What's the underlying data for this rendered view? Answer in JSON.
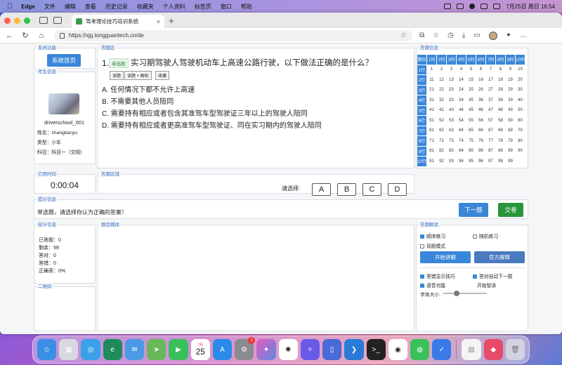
{
  "menubar": {
    "app": "Edge",
    "items": [
      "文件",
      "编辑",
      "查看",
      "历史记录",
      "收藏夹",
      "个人资料",
      "标签页",
      "窗口",
      "帮助"
    ],
    "datetime": "7月25日 周日 16:54"
  },
  "browser": {
    "tab_title": "驾考理论技巧培训系统",
    "url": "https://xjg.tongguantech.cn/de"
  },
  "system": {
    "title": "系统功能",
    "home_button": "系统首页"
  },
  "student": {
    "title": "考生信息",
    "username": "driverschool_001",
    "name_label": "姓名：",
    "name": "zhangtianyu",
    "type_label": "类型：",
    "type": "小车",
    "subject_label": "科目：",
    "subject": "科目一（交规）"
  },
  "question": {
    "area_title": "答题区",
    "number": "1.",
    "tag": "单选题",
    "text": "实习期驾驶人驾驶机动车上高速公路行驶，以下做法正确的是什么？",
    "buttons": [
      "读题",
      "读题 + 解析",
      "收藏"
    ],
    "options": [
      "A. 任何情况下都不允许上高速",
      "B. 不需要其他人员陪同",
      "C. 需要持有相应或者包含其准驾车型驾驶证三年以上的驾驶人陪同",
      "D. 需要持有相应或者更高准驾车型驾驶证、同在实习期内的驾驶人陪同"
    ]
  },
  "answer_info": {
    "title": "答题信息",
    "col_headers": [
      "题目",
      "1列",
      "2列",
      "3列",
      "4列",
      "5列",
      "6列",
      "7列",
      "8列",
      "9列",
      "10列"
    ],
    "row_headers": [
      "1行",
      "2行",
      "3行",
      "4行",
      "5行",
      "6行",
      "7行",
      "8行",
      "9行",
      "10行"
    ],
    "total": 99
  },
  "timer": {
    "title": "已用时间",
    "value": "0:00:04"
  },
  "answer_area": {
    "title": "答题区域",
    "prompt": "请选择:",
    "choices": [
      "A",
      "B",
      "C",
      "D"
    ]
  },
  "hint": {
    "title": "提示信息",
    "text": "单选题，请选择你认为正确的答案！",
    "next_button": "下一题",
    "submit_button": "交卷"
  },
  "stats": {
    "title": "统计信息",
    "rows": [
      {
        "label": "已答题：",
        "value": "0"
      },
      {
        "label": "剩余：",
        "value": "99"
      },
      {
        "label": "答对：",
        "value": "0"
      },
      {
        "label": "答错：",
        "value": "0"
      },
      {
        "label": "正确率：",
        "value": "0%"
      }
    ]
  },
  "media": {
    "title": "题目媒体"
  },
  "qrcode": {
    "title": "二维码"
  },
  "explain": {
    "title": "答题解说",
    "sequential": "顺序练习",
    "random": "随机练习",
    "recite": "背题模式",
    "start_button": "开始讲解",
    "official_button": "官方解释",
    "show_tips_wrong": "答错显示技巧",
    "auto_next": "答对自动下一题",
    "voice": "语音功能",
    "smart_read": "开始智读",
    "font_size": "字体大小",
    "font_size_value": 0.3
  },
  "dock": {
    "calendar_month": "7月",
    "calendar_day": "25",
    "settings_badge": "1"
  }
}
